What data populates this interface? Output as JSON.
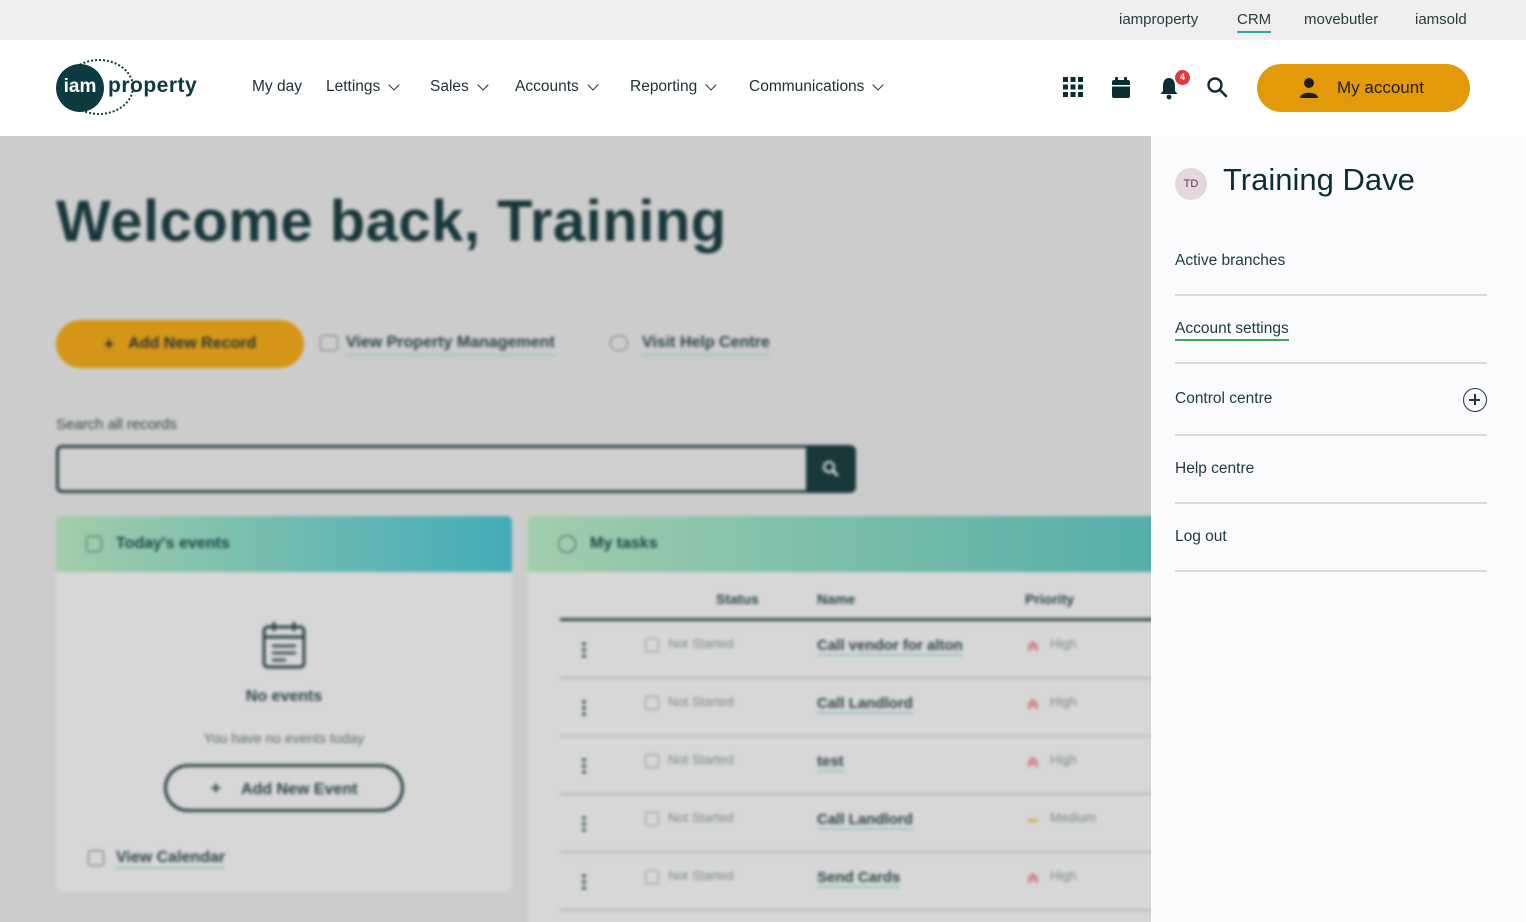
{
  "topbar": {
    "links": [
      "iamproperty",
      "CRM",
      "movebutler",
      "iamsold"
    ],
    "active": "CRM"
  },
  "logo": {
    "mark": "iam",
    "word": "property"
  },
  "nav": {
    "items": [
      "My day",
      "Lettings",
      "Sales",
      "Accounts",
      "Reporting",
      "Communications"
    ],
    "notifications_count": "4",
    "account_label": "My account"
  },
  "main": {
    "welcome": "Welcome back, Training",
    "add_record": "Add New Record",
    "view_property": "View Property Management",
    "help_centre": "Visit Help Centre",
    "search_label": "Search all records"
  },
  "events": {
    "title": "Today's events",
    "empty_title": "No events",
    "empty_text": "You have no events today",
    "add_event": "Add New Event",
    "view_calendar": "View Calendar"
  },
  "tasks": {
    "title": "My tasks",
    "columns": [
      "Status",
      "Name",
      "Priority"
    ],
    "rows": [
      {
        "status": "Not Started",
        "name": "Call vendor for alton",
        "priority": "High"
      },
      {
        "status": "Not Started",
        "name": "Call Landlord",
        "priority": "High"
      },
      {
        "status": "Not Started",
        "name": "test",
        "priority": "High"
      },
      {
        "status": "Not Started",
        "name": "Call Landlord",
        "priority": "Medium"
      },
      {
        "status": "Not Started",
        "name": "Send Cards",
        "priority": "High"
      }
    ]
  },
  "panel": {
    "initials": "TD",
    "name": "Training Dave",
    "items": [
      "Active branches",
      "Account settings",
      "Control centre",
      "Help centre",
      "Log out"
    ]
  },
  "colors": {
    "brand_dark": "#0b2e33",
    "accent": "#e29a0b",
    "underline": "#3aa75f",
    "priority_high": "#e0707a",
    "priority_medium": "#e2b33a"
  }
}
